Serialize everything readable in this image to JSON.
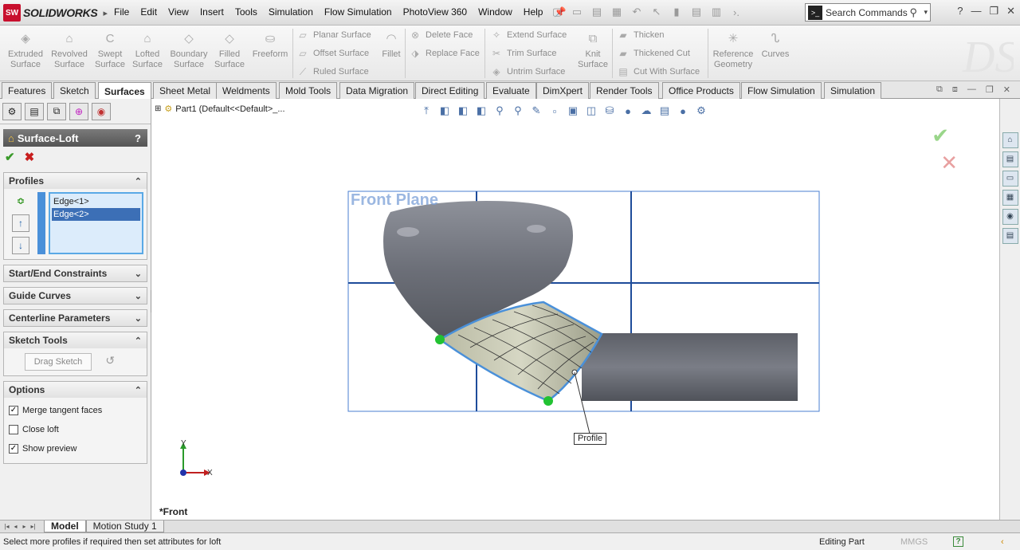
{
  "app": {
    "brand": "SOLIDWORKS",
    "logo": "SW"
  },
  "menu": [
    "File",
    "Edit",
    "View",
    "Insert",
    "Tools",
    "Simulation",
    "Flow Simulation",
    "PhotoView 360",
    "Window",
    "Help"
  ],
  "search": {
    "placeholder": "Search Commands",
    "icon": "terminal-icon"
  },
  "ribbon": {
    "big": [
      "Extruded Surface",
      "Revolved Surface",
      "Swept Surface",
      "Lofted Surface",
      "Boundary Surface",
      "Filled Surface",
      "Freeform"
    ],
    "col1": [
      "Planar Surface",
      "Offset Surface",
      "Ruled Surface"
    ],
    "fillet": "Fillet",
    "col2": [
      "Delete Face",
      "Replace Face"
    ],
    "col3": [
      "Extend Surface",
      "Trim Surface",
      "Untrim Surface"
    ],
    "knit": "Knit Surface",
    "col4": [
      "Thicken",
      "Thickened Cut",
      "Cut With Surface"
    ],
    "reference": "Reference Geometry",
    "curves": "Curves"
  },
  "tabs": [
    "Features",
    "Sketch",
    "Surfaces",
    "Sheet Metal",
    "Weldments",
    "Mold Tools",
    "Data Migration",
    "Direct Editing",
    "Evaluate",
    "DimXpert",
    "Render Tools",
    "Office Products",
    "Flow Simulation",
    "Simulation"
  ],
  "active_tab": "Surfaces",
  "property_manager": {
    "title": "Surface-Loft",
    "help": "?",
    "groups": {
      "profiles": "Profiles",
      "start_end": "Start/End Constraints",
      "guide_curves": "Guide Curves",
      "centerline": "Centerline Parameters",
      "sketch_tools": "Sketch Tools",
      "options": "Options"
    },
    "profiles": [
      "Edge<1>",
      "Edge<2>"
    ],
    "drag_sketch": "Drag Sketch",
    "options": [
      {
        "label": "Merge tangent faces",
        "checked": true
      },
      {
        "label": "Close loft",
        "checked": false
      },
      {
        "label": "Show preview",
        "checked": true
      }
    ]
  },
  "tree_item": "Part1  (Default<<Default>_...",
  "plane_label": "Front Plane",
  "callout": "Profile",
  "axes": {
    "x": "X",
    "y": "Y"
  },
  "view_name": "*Front",
  "bottom_tabs": [
    "Model",
    "Motion Study 1"
  ],
  "status": {
    "message": "Select more profiles if required then set attributes for loft",
    "mode": "Editing Part",
    "units": "MMGS"
  },
  "colors": {
    "accent": "#3c6fb6",
    "selection": "#4a90d9",
    "ok": "#3a9a2a",
    "cancel": "#c81e1e",
    "plane": "#2a5db0"
  }
}
